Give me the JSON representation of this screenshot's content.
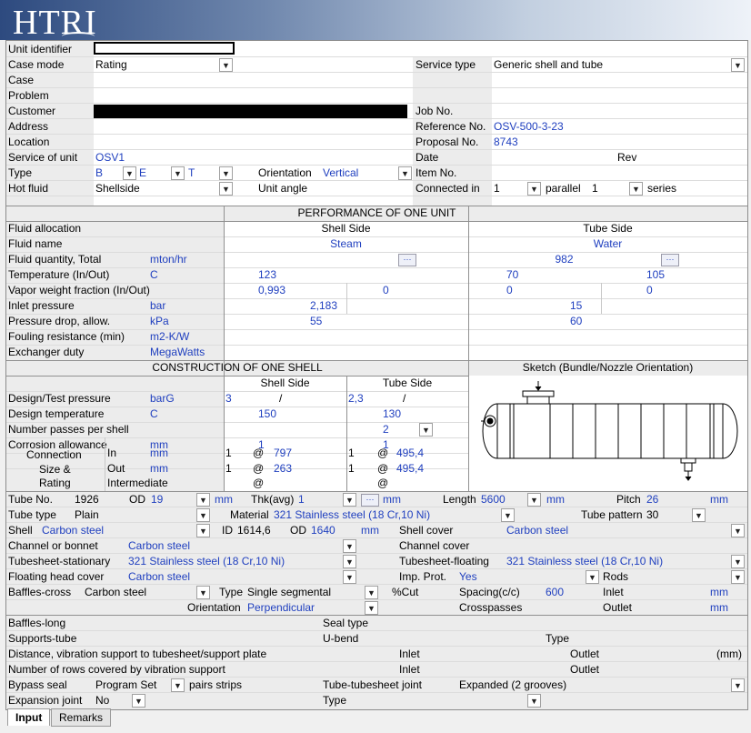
{
  "app": {
    "logo": "HTRI"
  },
  "header": {
    "unit_identifier_label": "Unit identifier",
    "unit_identifier": "",
    "case_mode_label": "Case mode",
    "case_mode": "Rating",
    "service_type_label": "Service type",
    "service_type": "Generic shell and tube",
    "case_label": "Case",
    "problem_label": "Problem",
    "customer_label": "Customer",
    "job_no_label": "Job No.",
    "address_label": "Address",
    "reference_no_label": "Reference No.",
    "reference_no": "OSV-500-3-23",
    "location_label": "Location",
    "proposal_no_label": "Proposal No.",
    "proposal_no": "8743",
    "service_of_unit_label": "Service of unit",
    "service_of_unit": "OSV1",
    "date_label": "Date",
    "rev_label": "Rev",
    "type_label": "Type",
    "type_front": "B",
    "type_shell": "E",
    "type_rear": "T",
    "orientation_label": "Orientation",
    "orientation": "Vertical",
    "item_no_label": "Item No.",
    "hot_fluid_label": "Hot fluid",
    "hot_fluid": "Shellside",
    "unit_angle_label": "Unit angle",
    "connected_in_label": "Connected in",
    "connected_parallel": "1",
    "parallel_label": "parallel",
    "connected_series": "1",
    "series_label": "series"
  },
  "performance": {
    "title": "PERFORMANCE OF ONE UNIT",
    "shell_side_label": "Shell Side",
    "tube_side_label": "Tube Side",
    "fluid_allocation_label": "Fluid allocation",
    "fluid_name_label": "Fluid name",
    "shell_fluid": "Steam",
    "tube_fluid": "Water",
    "fluid_quantity_label": "Fluid quantity, Total",
    "fluid_quantity_unit": "mton/hr",
    "tube_quantity": "982",
    "temperature_label": "Temperature (In/Out)",
    "temperature_unit": "C",
    "shell_temp_in": "123",
    "tube_temp_in": "70",
    "tube_temp_out": "105",
    "vapor_label": "Vapor weight fraction (In/Out)",
    "shell_vapor_in": "0,993",
    "shell_vapor_out": "0",
    "tube_vapor_in": "0",
    "tube_vapor_out": "0",
    "inlet_pressure_label": "Inlet pressure",
    "inlet_pressure_unit": "bar",
    "shell_inlet_pressure": "2,183",
    "tube_inlet_pressure": "15",
    "pressure_drop_label": "Pressure drop, allow.",
    "pressure_drop_unit": "kPa",
    "shell_pressure_drop": "55",
    "tube_pressure_drop": "60",
    "fouling_label": "Fouling resistance (min)",
    "fouling_unit": "m2-K/W",
    "duty_label": "Exchanger duty",
    "duty_unit": "MegaWatts",
    "ellipsis": "···"
  },
  "construction": {
    "title": "CONSTRUCTION OF ONE SHELL",
    "sketch_title": "Sketch (Bundle/Nozzle Orientation)",
    "shell_side_label": "Shell Side",
    "tube_side_label": "Tube Side",
    "design_pressure_label": "Design/Test pressure",
    "design_pressure_unit": "barG",
    "shell_design_pressure": "3",
    "tube_design_pressure": "2,3",
    "slash": "/",
    "design_temp_label": "Design temperature",
    "design_temp_unit": "C",
    "shell_design_temp": "150",
    "tube_design_temp": "130",
    "passes_label": "Number passes per shell",
    "tube_passes": "2",
    "corrosion_label": "Corrosion allowance",
    "corrosion_unit": "mm",
    "shell_corrosion": "1",
    "tube_corrosion": "1",
    "connection_label_1": "Connection",
    "connection_label_2": "Size &",
    "connection_label_3": "Rating",
    "in_label": "In",
    "out_label": "Out",
    "intermediate_label": "Intermediate",
    "conn_unit": "mm",
    "at": "@",
    "shell_in_count": "1",
    "shell_in_size": "797",
    "tube_in_count": "1",
    "tube_in_size": "495,4",
    "shell_out_count": "1",
    "shell_out_size": "263",
    "tube_out_count": "1",
    "tube_out_size": "495,4"
  },
  "tubes": {
    "tube_no_label": "Tube No.",
    "tube_no": "1926",
    "od_label": "OD",
    "od": "19",
    "od_unit": "mm",
    "thk_label": "Thk(avg)",
    "thk": "1",
    "thk_unit": "mm",
    "length_label": "Length",
    "length": "5600",
    "length_unit": "mm",
    "pitch_label": "Pitch",
    "pitch": "26",
    "pitch_unit": "mm",
    "tube_type_label": "Tube type",
    "tube_type": "Plain",
    "material_label": "Material",
    "material": "321 Stainless steel (18 Cr,10 Ni)",
    "tube_pattern_label": "Tube pattern",
    "tube_pattern": "30",
    "shell_label": "Shell",
    "shell_material": "Carbon steel",
    "id_label": "ID",
    "shell_id": "1614,6",
    "shell_od_label": "OD",
    "shell_od": "1640",
    "shell_unit": "mm",
    "shell_cover_label": "Shell cover",
    "shell_cover": "Carbon steel",
    "channel_label": "Channel or bonnet",
    "channel": "Carbon steel",
    "channel_cover_label": "Channel cover",
    "ts_stationary_label": "Tubesheet-stationary",
    "ts_stationary": "321 Stainless steel (18 Cr,10 Ni)",
    "ts_floating_label": "Tubesheet-floating",
    "ts_floating": "321 Stainless steel (18 Cr,10 Ni)",
    "floating_head_label": "Floating head cover",
    "floating_head": "Carbon steel",
    "imp_prot_label": "Imp. Prot.",
    "imp_prot": "Yes",
    "rods_label": "Rods"
  },
  "baffles": {
    "cross_label": "Baffles-cross",
    "cross_material": "Carbon steel",
    "type_label": "Type",
    "type": "Single segmental",
    "cut_label": "%Cut",
    "spacing_label": "Spacing(c/c)",
    "spacing": "600",
    "inlet_label": "Inlet",
    "inlet_unit": "mm",
    "orientation_label": "Orientation",
    "orientation": "Perpendicular",
    "crosspasses_label": "Crosspasses",
    "outlet_label": "Outlet",
    "outlet_unit": "mm",
    "long_label": "Baffles-long",
    "seal_type_label": "Seal type",
    "supports_label": "Supports-tube",
    "ubend_label": "U-bend",
    "supports_type_label": "Type",
    "distance_label": "Distance, vibration support to tubesheet/support plate",
    "distance_inlet_label": "Inlet",
    "distance_outlet_label": "Outlet",
    "distance_unit": "(mm)",
    "rows_label": "Number of rows covered by vibration support",
    "rows_inlet_label": "Inlet",
    "rows_outlet_label": "Outlet",
    "bypass_label": "Bypass seal",
    "bypass": "Program Set",
    "pairs_label": "pairs strips",
    "tt_joint_label": "Tube-tubesheet joint",
    "tt_joint": "Expanded (2 grooves)",
    "expansion_label": "Expansion joint",
    "expansion": "No",
    "expansion_type_label": "Type"
  },
  "tabs": {
    "input": "Input",
    "remarks": "Remarks"
  },
  "colors": {
    "value_text": "#1f3fbf",
    "banner_dark": "#2d4a7f"
  }
}
